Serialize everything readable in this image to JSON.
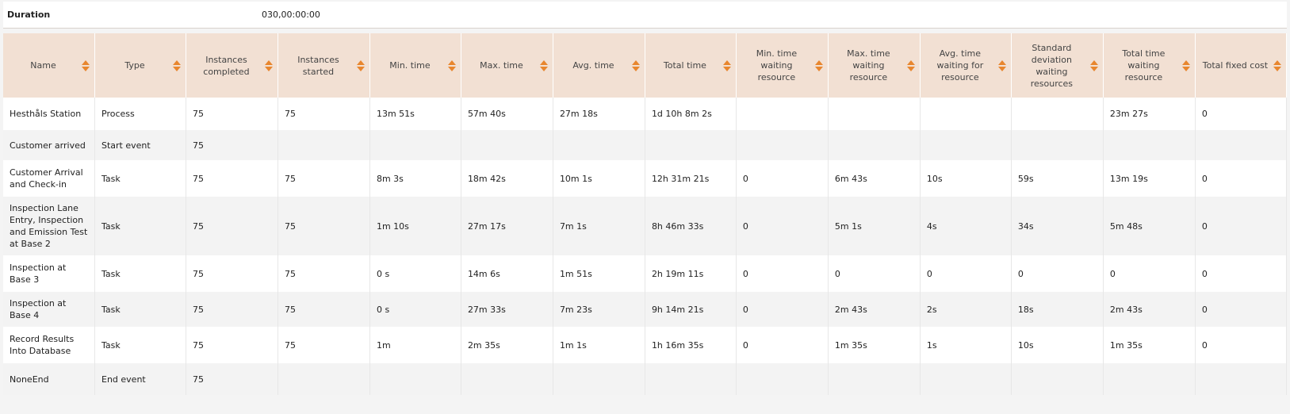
{
  "duration": {
    "label": "Duration",
    "value": "030,00:00:00"
  },
  "columns": [
    "Name",
    "Type",
    "Instances completed",
    "Instances started",
    "Min. time",
    "Max. time",
    "Avg. time",
    "Total time",
    "Min. time waiting resource",
    "Max. time waiting resource",
    "Avg. time waiting for resource",
    "Standard deviation waiting resources",
    "Total time waiting resource",
    "Total fixed cost"
  ],
  "rows": [
    [
      "Hesthåls Station",
      "Process",
      "75",
      "75",
      "13m 51s",
      "57m 40s",
      "27m 18s",
      "1d 10h 8m 2s",
      "",
      "",
      "",
      "",
      "23m 27s",
      "0"
    ],
    [
      "Customer arrived",
      "Start event",
      "75",
      "",
      "",
      "",
      "",
      "",
      "",
      "",
      "",
      "",
      "",
      ""
    ],
    [
      "Customer Arrival and Check-in",
      "Task",
      "75",
      "75",
      "8m 3s",
      "18m 42s",
      "10m 1s",
      "12h 31m 21s",
      "0",
      "6m 43s",
      "10s",
      "59s",
      "13m 19s",
      "0"
    ],
    [
      "Inspection Lane Entry, Inspection and Emission Test at Base 2",
      "Task",
      "75",
      "75",
      "1m 10s",
      "27m 17s",
      "7m 1s",
      "8h 46m 33s",
      "0",
      "5m 1s",
      "4s",
      "34s",
      "5m 48s",
      "0"
    ],
    [
      "Inspection at Base 3",
      "Task",
      "75",
      "75",
      "0 s",
      "14m 6s",
      "1m 51s",
      "2h 19m 11s",
      "0",
      "0",
      "0",
      "0",
      "0",
      "0"
    ],
    [
      "Inspection at Base 4",
      "Task",
      "75",
      "75",
      "0 s",
      "27m 33s",
      "7m 23s",
      "9h 14m 21s",
      "0",
      "2m 43s",
      "2s",
      "18s",
      "2m 43s",
      "0"
    ],
    [
      "Record Results Into Database",
      "Task",
      "75",
      "75",
      "1m",
      "2m 35s",
      "1m 1s",
      "1h 16m 35s",
      "0",
      "1m 35s",
      "1s",
      "10s",
      "1m 35s",
      "0"
    ],
    [
      "NoneEnd",
      "End event",
      "75",
      "",
      "",
      "",
      "",
      "",
      "",
      "",
      "",
      "",
      "",
      ""
    ]
  ]
}
